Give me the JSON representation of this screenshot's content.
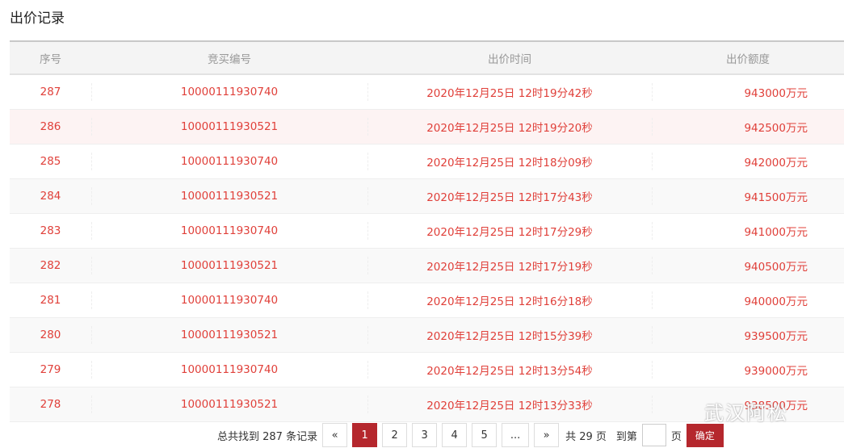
{
  "title": "出价记录",
  "headers": [
    "序号",
    "竞买编号",
    "出价时间",
    "出价额度"
  ],
  "rows": [
    [
      "287",
      "10000111930740",
      "2020年12月25日 12时19分42秒",
      "943000万元"
    ],
    [
      "286",
      "10000111930521",
      "2020年12月25日 12时19分20秒",
      "942500万元"
    ],
    [
      "285",
      "10000111930740",
      "2020年12月25日 12时18分09秒",
      "942000万元"
    ],
    [
      "284",
      "10000111930521",
      "2020年12月25日 12时17分43秒",
      "941500万元"
    ],
    [
      "283",
      "10000111930740",
      "2020年12月25日 12时17分29秒",
      "941000万元"
    ],
    [
      "282",
      "10000111930521",
      "2020年12月25日 12时17分19秒",
      "940500万元"
    ],
    [
      "281",
      "10000111930740",
      "2020年12月25日 12时16分18秒",
      "940000万元"
    ],
    [
      "280",
      "10000111930521",
      "2020年12月25日 12时15分39秒",
      "939500万元"
    ],
    [
      "279",
      "10000111930740",
      "2020年12月25日 12时13分54秒",
      "939000万元"
    ],
    [
      "278",
      "10000111930521",
      "2020年12月25日 12时13分33秒",
      "938500万元"
    ]
  ],
  "pager": {
    "total": "总共找到 287 条记录",
    "prev": "«",
    "pages": [
      "1",
      "2",
      "3",
      "4",
      "5",
      "..."
    ],
    "next": "»",
    "count": "共 29 页",
    "goto": "到第",
    "page_unit": "页",
    "confirm": "确定"
  },
  "watermark": "武汉阿松"
}
